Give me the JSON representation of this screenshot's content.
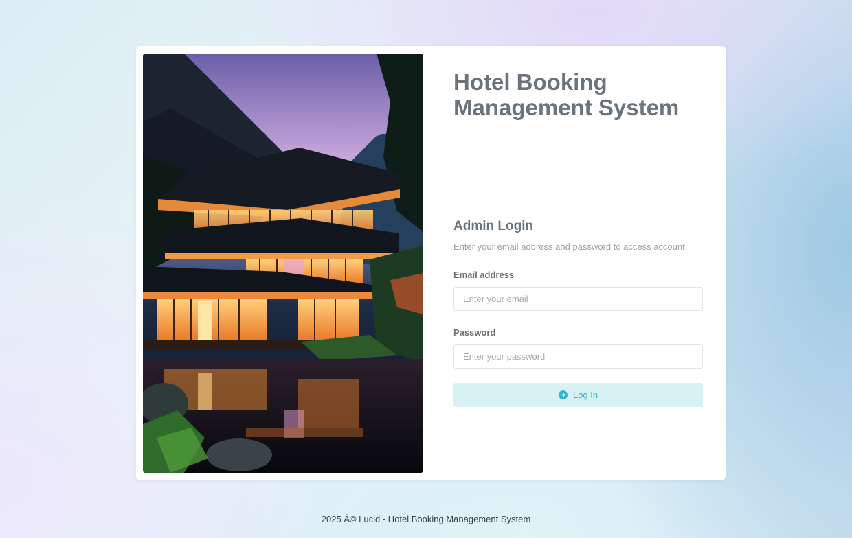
{
  "app": {
    "title": "Hotel Booking Management System"
  },
  "login": {
    "heading": "Admin Login",
    "subtitle": "Enter your email address and password to access account.",
    "email_label": "Email address",
    "email_placeholder": "Enter your email",
    "email_value": "",
    "password_label": "Password",
    "password_placeholder": "Enter your password",
    "password_value": "",
    "submit_label": "Log In",
    "submit_icon": "arrow-right-circle-icon"
  },
  "hero": {
    "image_subject": "modern-house-by-lake-at-dusk"
  },
  "footer": {
    "text": "2025 Â© Lucid - Hotel Booking Management System"
  },
  "colors": {
    "accent": "#2bb5c8",
    "button_bg": "#d7f1f4",
    "heading": "#6b737b",
    "muted": "#9aa1a7"
  }
}
